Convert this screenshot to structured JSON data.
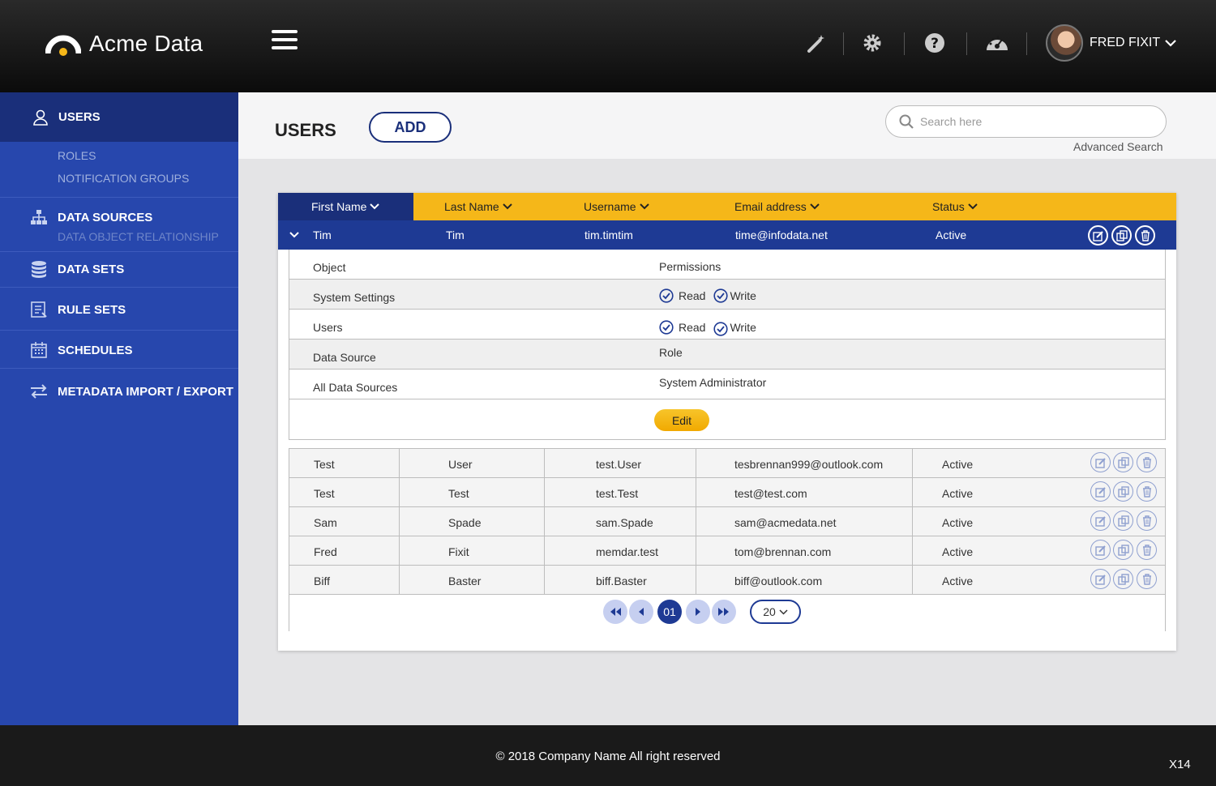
{
  "header": {
    "logo_text": "Acme Data",
    "user_name": "FRED FIXIT",
    "icons": [
      "magic-wand-icon",
      "gear-icon",
      "help-icon",
      "dashboard-icon"
    ]
  },
  "sidebar": {
    "users": "USERS",
    "roles": "ROLES",
    "notification_groups": "NOTIFICATION GROUPS",
    "data_sources": "DATA SOURCES",
    "data_object_relationship": "DATA OBJECT RELATIONSHIP",
    "data_sets": "DATA SETS",
    "rule_sets": "RULE SETS",
    "schedules": "SCHEDULES",
    "metadata": "METADATA IMPORT / EXPORT"
  },
  "page": {
    "title": "USERS",
    "add_label": "ADD",
    "search_placeholder": "Search here",
    "advanced_search": "Advanced Search"
  },
  "table": {
    "columns": [
      "First Name",
      "Last Name",
      "Username",
      "Email address",
      "Status"
    ],
    "expanded": {
      "first": "Tim",
      "last": "Tim",
      "username": "tim.timtim",
      "email": "time@infodata.net",
      "status": "Active"
    },
    "permissions": {
      "object_header": "Object",
      "permissions_header": "Permissions",
      "rows": [
        {
          "object": "System Settings",
          "read": "Read",
          "write": "Write"
        },
        {
          "object": "Users",
          "read": "Read",
          "write": "Write"
        }
      ],
      "data_source_header": "Data Source",
      "role_header": "Role",
      "data_source_value": "All Data Sources",
      "role_value": "System Administrator",
      "edit_label": "Edit"
    },
    "rows": [
      {
        "first": "Test",
        "last": "User",
        "username": "test.User",
        "email": "tesbrennan999@outlook.com",
        "status": "Active"
      },
      {
        "first": "Test",
        "last": "Test",
        "username": "test.Test",
        "email": "test@test.com",
        "status": "Active"
      },
      {
        "first": "Sam",
        "last": "Spade",
        "username": "sam.Spade",
        "email": "sam@acmedata.net",
        "status": "Active"
      },
      {
        "first": "Fred",
        "last": "Fixit",
        "username": "memdar.test",
        "email": "tom@brennan.com",
        "status": "Active"
      },
      {
        "first": "Biff",
        "last": "Baster",
        "username": "biff.Baster",
        "email": "biff@outlook.com",
        "status": "Active"
      }
    ],
    "pager": {
      "current": "01",
      "page_size": "20"
    }
  },
  "footer": {
    "copyright": "© 2018 Company Name  All right reserved",
    "code": "X14"
  },
  "colors": {
    "primary": "#2747ad",
    "dark": "#1a2f7a",
    "accent": "#f5b719"
  }
}
